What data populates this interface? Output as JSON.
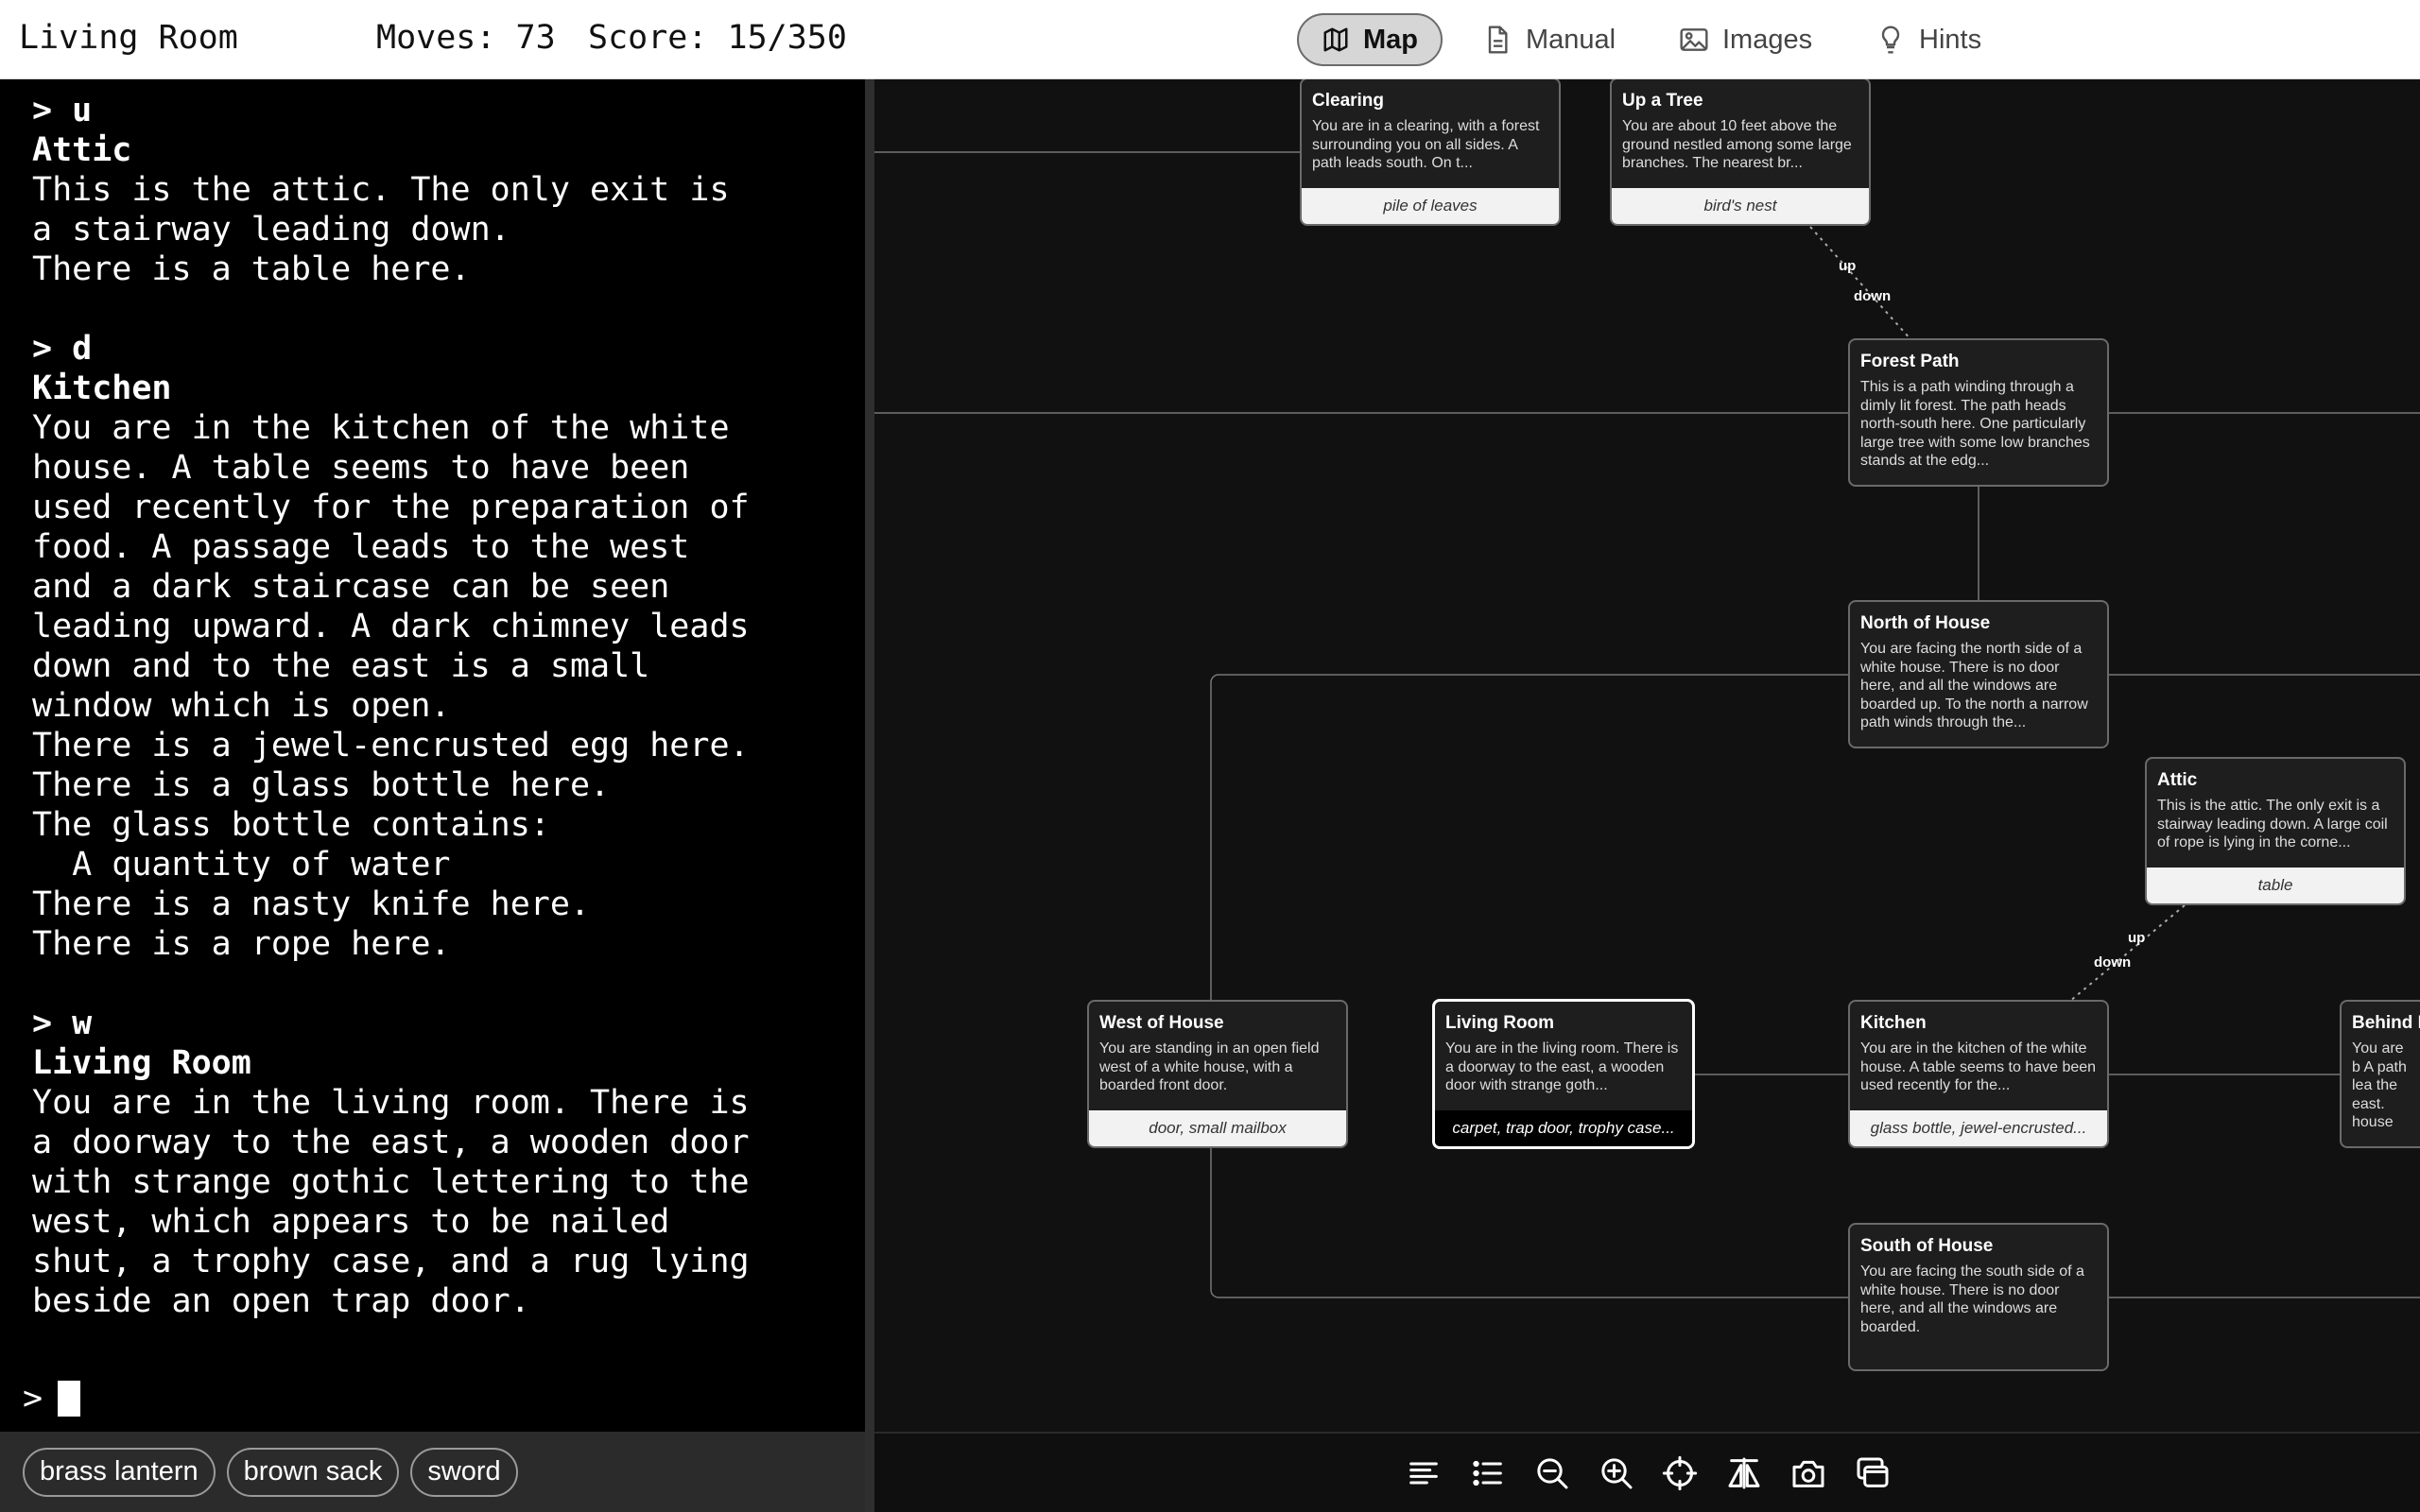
{
  "header": {
    "room": "Living Room",
    "moves": "Moves: 73",
    "score": "Score: 15/350",
    "tabs": {
      "map": "Map",
      "manual": "Manual",
      "images": "Images",
      "hints": "Hints"
    }
  },
  "terminal": {
    "blocks": [
      {
        "command": "> u",
        "title": "Attic",
        "lines": [
          "This is the attic. The only exit is",
          "a stairway leading down.",
          "There is a table here."
        ]
      },
      {
        "command": "> d",
        "title": "Kitchen",
        "lines": [
          "You are in the kitchen of the white",
          "house. A table seems to have been",
          "used recently for the preparation of",
          "food. A passage leads to the west",
          "and a dark staircase can be seen",
          "leading upward. A dark chimney leads",
          "down and to the east is a small",
          "window which is open.",
          "There is a jewel-encrusted egg here.",
          "There is a glass bottle here.",
          "The glass bottle contains:",
          "  A quantity of water",
          "There is a nasty knife here.",
          "There is a rope here."
        ]
      },
      {
        "command": "> w",
        "title": "Living Room",
        "lines": [
          "You are in the living room. There is",
          "a doorway to the east, a wooden door",
          "with strange gothic lettering to the",
          "west, which appears to be nailed",
          "shut, a trophy case, and a rug lying",
          "beside an open trap door."
        ]
      }
    ],
    "prompt": ">"
  },
  "inventory": [
    "brass lantern",
    "brown sack",
    "sword"
  ],
  "map": {
    "rooms": [
      {
        "name": "Clearing",
        "desc": "You are in a clearing, with a forest surrounding you on all sides. A path leads south. On t...",
        "items": "pile of leaves"
      },
      {
        "name": "Up a Tree",
        "desc": "You are about 10 feet above the ground nestled among some large branches. The nearest br...",
        "items": "bird's nest"
      },
      {
        "name": "Forest Path",
        "desc": "This is a path winding through a dimly lit forest. The path heads north-south here. One particularly large tree with some low branches stands at the edg...",
        "items": ""
      },
      {
        "name": "North of House",
        "desc": "You are facing the north side of a white house. There is no door here, and all the windows are boarded up. To the north a narrow path winds through the...",
        "items": ""
      },
      {
        "name": "Attic",
        "desc": "This is the attic. The only exit is a stairway leading down. A large coil of rope is lying in the corne...",
        "items": "table"
      },
      {
        "name": "West of House",
        "desc": "You are standing in an open field west of a white house, with a boarded front door.",
        "items": "door, small mailbox"
      },
      {
        "name": "Living Room",
        "desc": "You are in the living room. There is a doorway to the east, a wooden door with strange goth...",
        "items": "carpet, trap door, trophy case..."
      },
      {
        "name": "Kitchen",
        "desc": "You are in the kitchen of the white house. A table seems to have been used recently for the...",
        "items": "glass bottle, jewel-encrusted..."
      },
      {
        "name": "Behind H",
        "desc": "You are b A path lea the east. house the which is",
        "items": ""
      },
      {
        "name": "South of House",
        "desc": "You are facing the south side of a white house. There is no door here, and all the windows are boarded.",
        "items": ""
      }
    ],
    "labels": {
      "tree_up": "up",
      "tree_down": "down",
      "attic_up": "up",
      "attic_down": "down"
    }
  },
  "toolbar": [
    "align-left-icon",
    "list-icon",
    "zoom-out-icon",
    "zoom-in-icon",
    "crosshair-icon",
    "flip-icon",
    "camera-icon",
    "windows-icon"
  ]
}
